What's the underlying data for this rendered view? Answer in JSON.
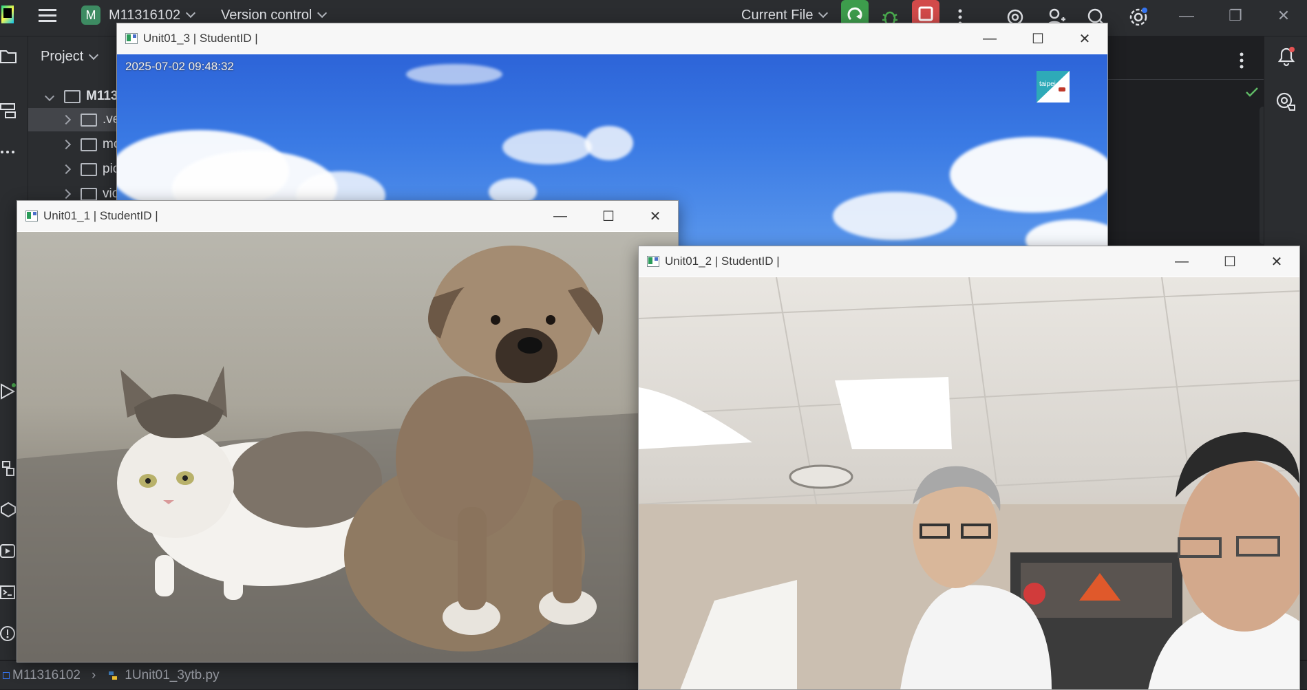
{
  "ide": {
    "project_badge": "M",
    "project_name": "M11316102",
    "vcs_label": "Version control",
    "run_config": "Current File",
    "panel_title": "Project",
    "tree": [
      {
        "label": "M113"
      },
      {
        "label": ".ve"
      },
      {
        "label": "mo"
      },
      {
        "label": "pic"
      },
      {
        "label": "vic"
      }
    ],
    "status_project": "M11316102",
    "status_file": "1Unit01_3ytb.py"
  },
  "windows": {
    "unit3": {
      "title": "Unit01_3 | StudentID |",
      "timestamp": "2025-07-02 09:48:32",
      "logo_text": "taipei"
    },
    "unit1": {
      "title": "Unit01_1 | StudentID |"
    },
    "unit2": {
      "title": "Unit01_2 | StudentID |"
    }
  },
  "colors": {
    "ide_bg": "#2b2d30",
    "run_green": "#3d9c4c",
    "stop_red": "#d24a4a",
    "badge_green": "#3d8b62"
  }
}
